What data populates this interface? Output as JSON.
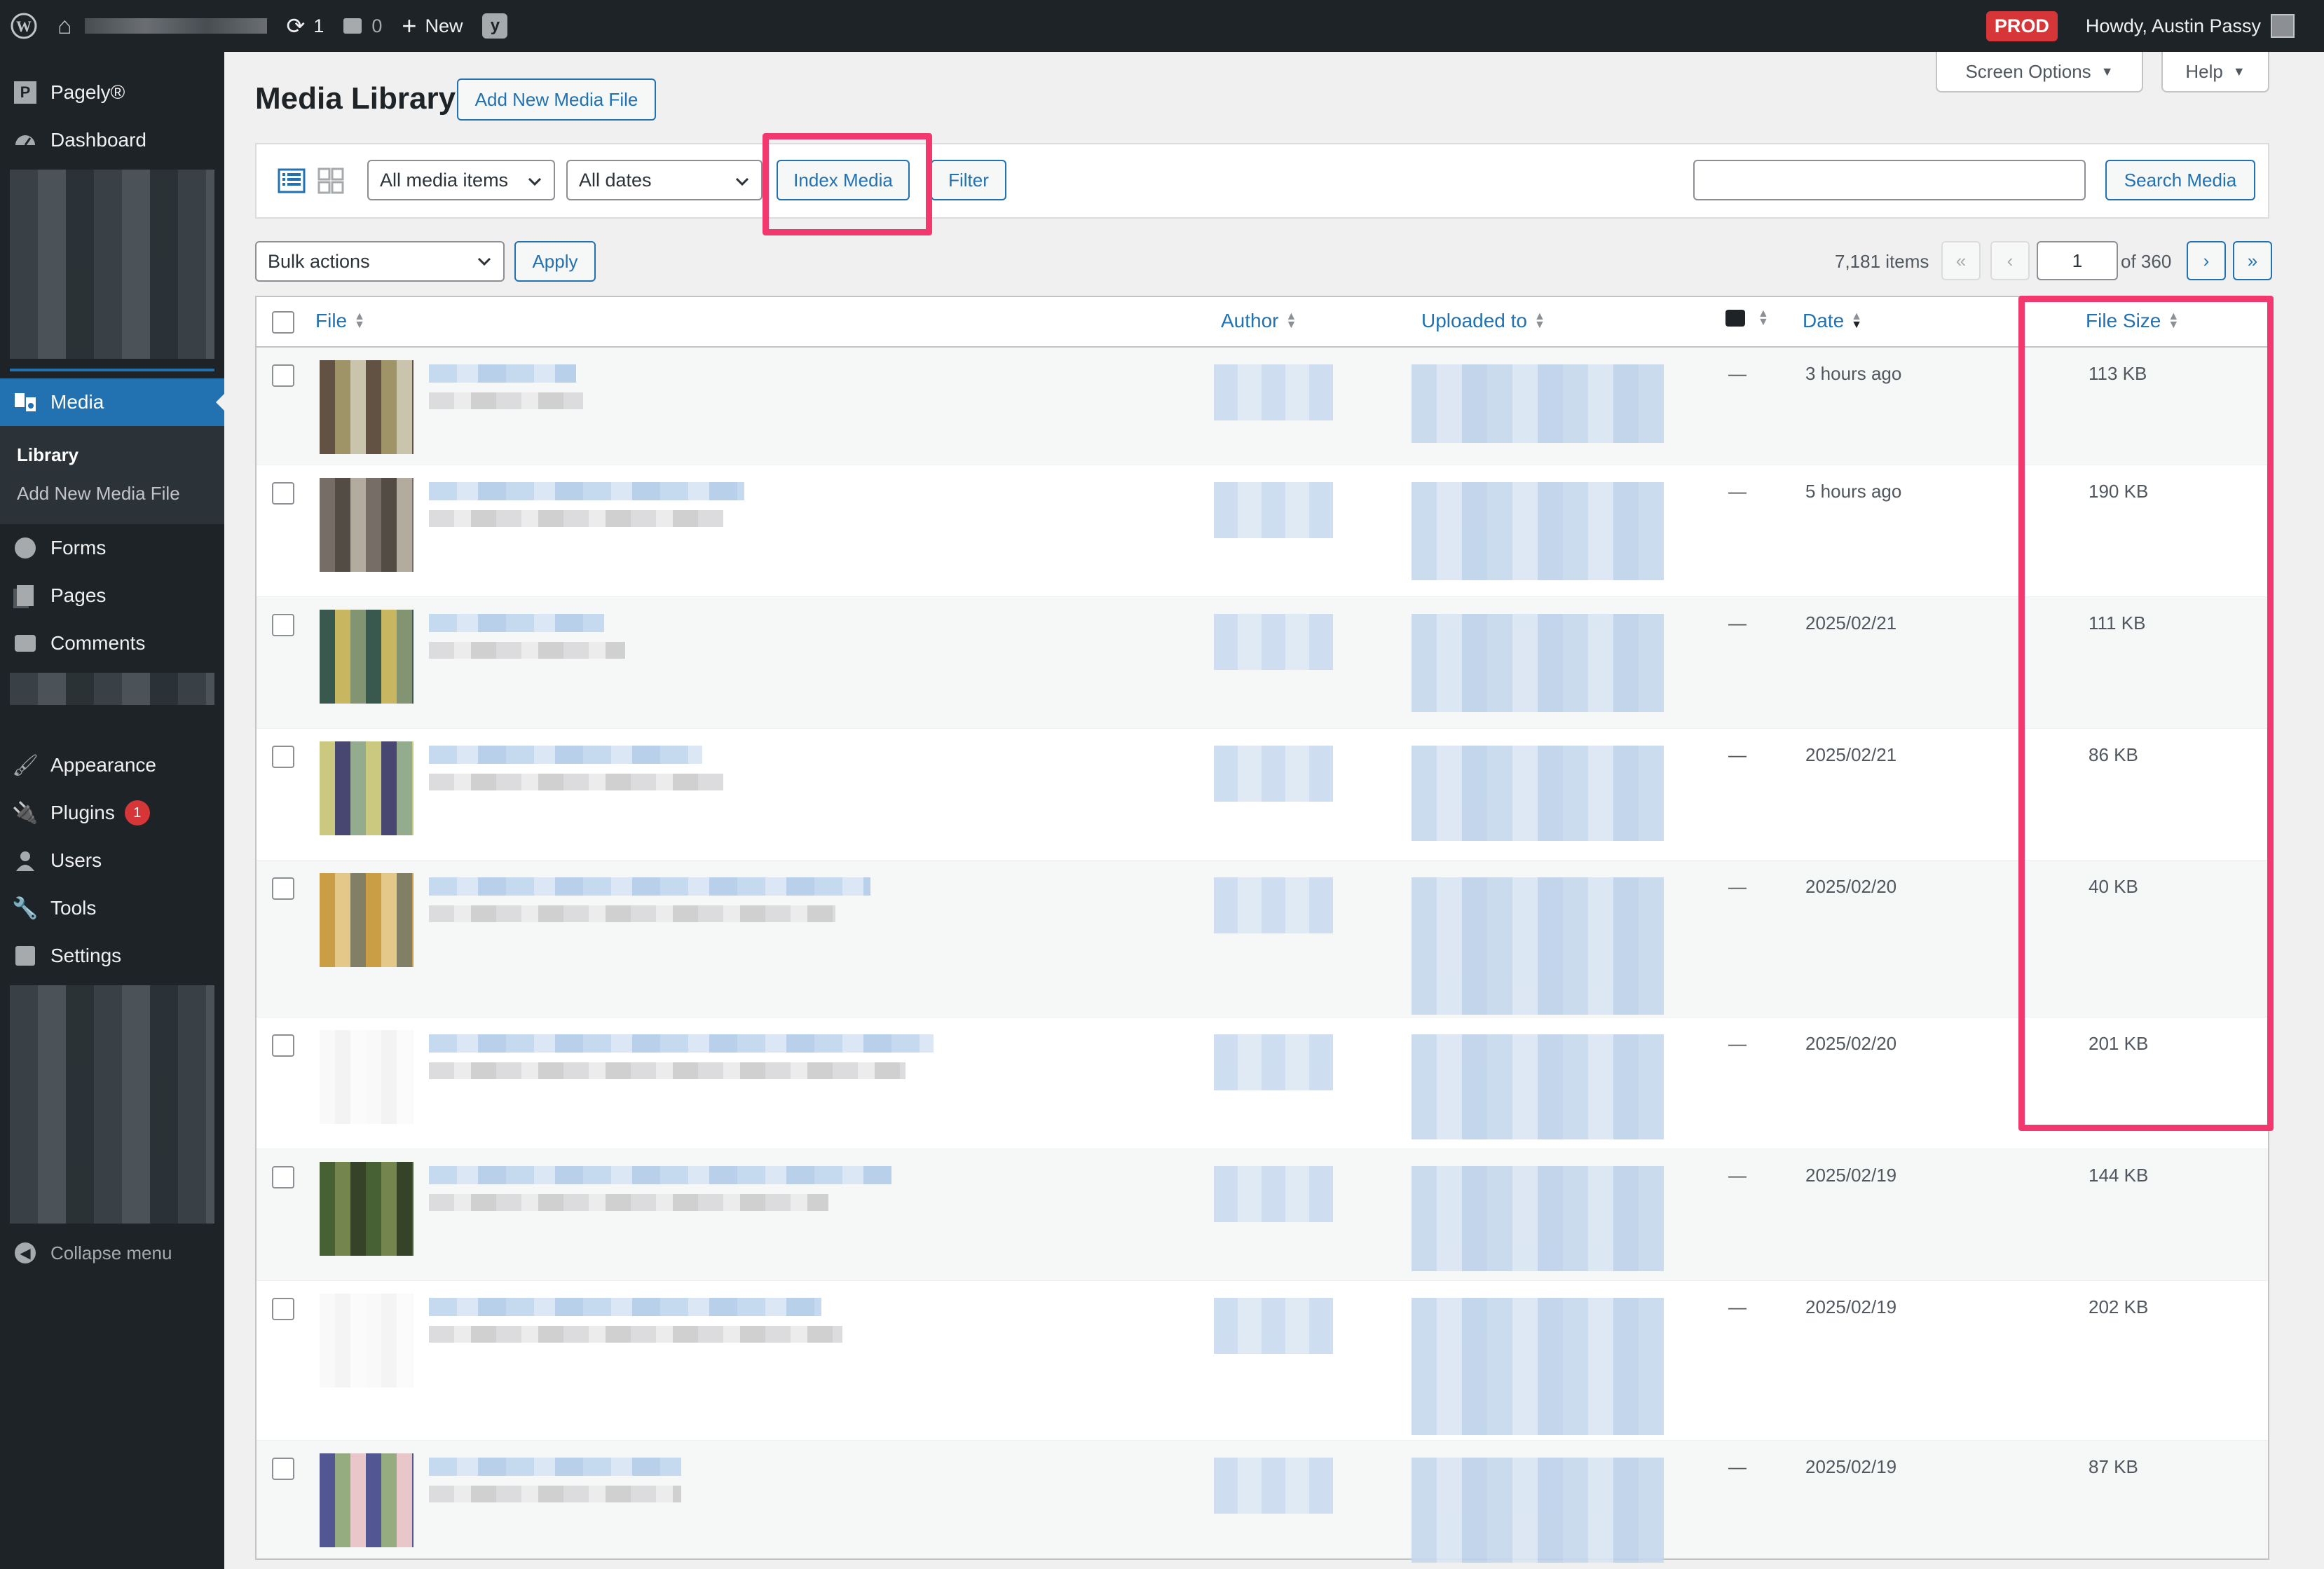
{
  "adminbar": {
    "updates_count": "1",
    "comments_count": "0",
    "new_label": "New",
    "env_badge": "PROD",
    "howdy": "Howdy, Austin Passy"
  },
  "sidebar": {
    "items": [
      {
        "label": "Pagely®",
        "icon": "pagely-icon"
      },
      {
        "label": "Dashboard",
        "icon": "dashboard-icon"
      },
      {
        "label": "Media",
        "icon": "media-icon"
      },
      {
        "label": "Forms",
        "icon": "forms-icon"
      },
      {
        "label": "Pages",
        "icon": "pages-icon"
      },
      {
        "label": "Comments",
        "icon": "comments-icon"
      },
      {
        "label": "Appearance",
        "icon": "appearance-icon"
      },
      {
        "label": "Plugins",
        "icon": "plugins-icon",
        "badge": "1"
      },
      {
        "label": "Users",
        "icon": "users-icon"
      },
      {
        "label": "Tools",
        "icon": "tools-icon"
      },
      {
        "label": "Settings",
        "icon": "settings-icon"
      }
    ],
    "submenu": [
      "Library",
      "Add New Media File"
    ],
    "collapse": "Collapse menu"
  },
  "header": {
    "title": "Media Library",
    "add_new": "Add New Media File",
    "screen_options": "Screen Options",
    "help": "Help"
  },
  "filters": {
    "media_type": "All media items",
    "dates": "All dates",
    "index_media": "Index Media",
    "filter": "Filter",
    "search_button": "Search Media"
  },
  "tablenav": {
    "bulk_actions": "Bulk actions",
    "apply": "Apply",
    "items_count": "7,181 items",
    "current_page": "1",
    "total_pages": "of 360"
  },
  "table": {
    "columns": [
      "File",
      "Author",
      "Uploaded to",
      "Date",
      "File Size"
    ],
    "rows": [
      {
        "comments": "—",
        "date": "3 hours ago",
        "size": "113 KB"
      },
      {
        "comments": "—",
        "date": "5 hours ago",
        "size": "190 KB"
      },
      {
        "comments": "—",
        "date": "2025/02/21",
        "size": "111 KB"
      },
      {
        "comments": "—",
        "date": "2025/02/21",
        "size": "86 KB"
      },
      {
        "comments": "—",
        "date": "2025/02/20",
        "size": "40 KB"
      },
      {
        "comments": "—",
        "date": "2025/02/20",
        "size": "201 KB"
      },
      {
        "comments": "—",
        "date": "2025/02/19",
        "size": "144 KB"
      },
      {
        "comments": "—",
        "date": "2025/02/19",
        "size": "202 KB"
      },
      {
        "comments": "—",
        "date": "2025/02/19",
        "size": "87 KB"
      }
    ]
  },
  "colors": {
    "admin_dark": "#1d2327",
    "accent_blue": "#2271b1",
    "highlight_pink": "#f2386f",
    "badge_red": "#d63638"
  }
}
